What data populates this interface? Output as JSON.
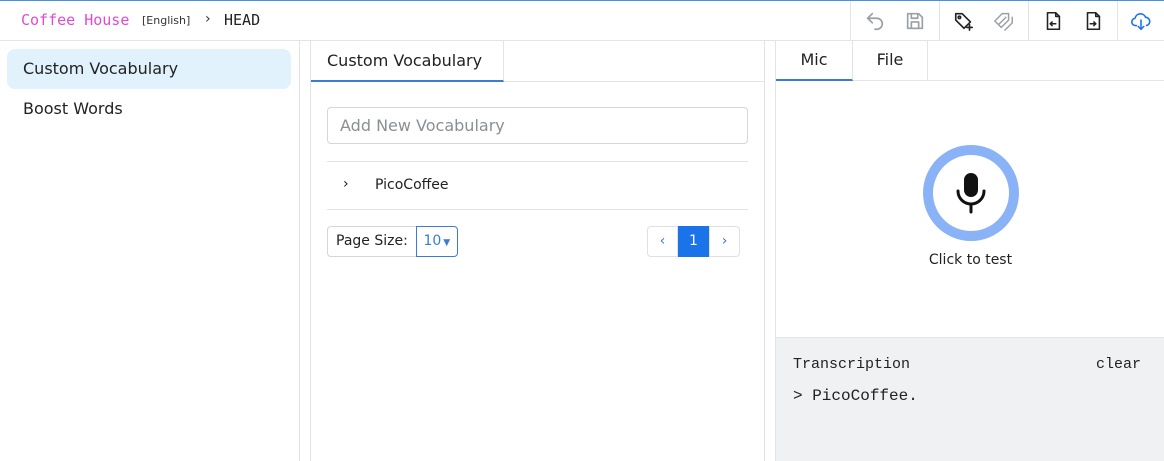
{
  "header": {
    "title": "Coffee House",
    "language": "[English]",
    "separator": "›",
    "branch": "HEAD"
  },
  "toolbar": {
    "icons": [
      "undo-icon",
      "save-icon",
      "add-tag-icon",
      "tags-icon",
      "import-file-icon",
      "export-file-icon",
      "cloud-download-icon"
    ]
  },
  "sidebar": {
    "items": [
      {
        "label": "Custom Vocabulary"
      },
      {
        "label": "Boost Words"
      }
    ]
  },
  "vocab": {
    "tab_label": "Custom Vocabulary",
    "input_placeholder": "Add New Vocabulary",
    "items": [
      {
        "chevron": "›",
        "label": "PicoCoffee"
      }
    ],
    "page_size_label": "Page Size:",
    "page_size_value": "10",
    "pager": {
      "prev": "‹",
      "current": "1",
      "next": "›"
    }
  },
  "test": {
    "tabs": [
      {
        "label": "Mic"
      },
      {
        "label": "File"
      }
    ],
    "mic_caption": "Click to test",
    "transcription_label": "Transcription",
    "clear_label": "clear",
    "transcription_text": "> PicoCoffee."
  },
  "colors": {
    "title": "#e04ad0",
    "accent": "#3a7bd5",
    "active_page": "#1a73e8",
    "sidebar_active": "#e1f2fc",
    "mic_ring": "#8ab3f7",
    "transcription_bg": "#f0f1f3"
  }
}
